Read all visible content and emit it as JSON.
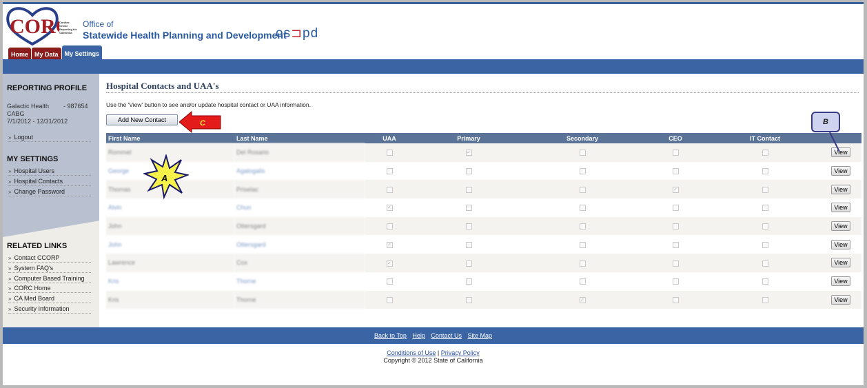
{
  "header": {
    "logo_text": "CORC",
    "logo_subtext": "Cardiac Online Reporting for California",
    "office_line1": "Office of",
    "office_line2": "Statewide Health Planning and Development",
    "oshpd": "osHpd"
  },
  "tabs": [
    {
      "label": "Home"
    },
    {
      "label": "My Data"
    },
    {
      "label": "My Settings",
      "active": true
    }
  ],
  "sidebar": {
    "profile_heading": "REPORTING PROFILE",
    "hospital": "Galactic Health",
    "hospital_id": "-   987654",
    "program": "CABG",
    "period": "7/1/2012 - 12/31/2012",
    "logout": "Logout",
    "settings_heading": "MY SETTINGS",
    "settings_items": [
      "Hospital Users",
      "Hospital Contacts",
      "Change Password"
    ],
    "related_heading": "RELATED LINKS",
    "related_items": [
      "Contact CCORP",
      "System FAQ's",
      "Computer Based Training",
      "CORC Home",
      "CA Med Board",
      "Security Information"
    ]
  },
  "main": {
    "title": "Hospital Contacts and UAA's",
    "intro": "Use the 'View' button to see and/or update hospital contact or UAA information.",
    "add_button": "Add New Contact",
    "columns": [
      "First Name",
      "Last Name",
      "UAA",
      "Primary",
      "Secondary",
      "CEO",
      "IT Contact"
    ],
    "view_label": "View",
    "rows": [
      {
        "first": "Rommel",
        "last": "Del Rosario",
        "uaa": false,
        "primary": true,
        "secondary": false,
        "ceo": false,
        "it": false
      },
      {
        "first": "George",
        "last": "Agalogalis",
        "uaa": false,
        "primary": false,
        "secondary": false,
        "ceo": false,
        "it": false
      },
      {
        "first": "Thomas",
        "last": "Priselac",
        "uaa": false,
        "primary": false,
        "secondary": false,
        "ceo": true,
        "it": false
      },
      {
        "first": "Alvin",
        "last": "Chun",
        "uaa": true,
        "primary": false,
        "secondary": false,
        "ceo": false,
        "it": false
      },
      {
        "first": "John",
        "last": "Ottersgard",
        "uaa": false,
        "primary": false,
        "secondary": false,
        "ceo": false,
        "it": false
      },
      {
        "first": "John",
        "last": "Ottersgard",
        "uaa": true,
        "primary": false,
        "secondary": false,
        "ceo": false,
        "it": false
      },
      {
        "first": "Lawrence",
        "last": "Cox",
        "uaa": true,
        "primary": false,
        "secondary": false,
        "ceo": false,
        "it": false
      },
      {
        "first": "Kris",
        "last": "Thorne",
        "uaa": false,
        "primary": false,
        "secondary": false,
        "ceo": false,
        "it": false
      },
      {
        "first": "Kris",
        "last": "Thorne",
        "uaa": false,
        "primary": false,
        "secondary": true,
        "ceo": false,
        "it": false
      }
    ]
  },
  "callouts": {
    "a": "A",
    "b": "B",
    "c": "C"
  },
  "footer": {
    "links": [
      "Back to Top",
      "Help",
      "Contact Us",
      "Site Map"
    ],
    "conditions": "Conditions of Use",
    "separator": "|",
    "privacy": "Privacy Policy",
    "copyright": "Copyright © 2012 State of California"
  },
  "colors": {
    "brand_blue": "#3a64a4",
    "tab_red": "#8c1d1d",
    "table_header": "#5a7397"
  }
}
